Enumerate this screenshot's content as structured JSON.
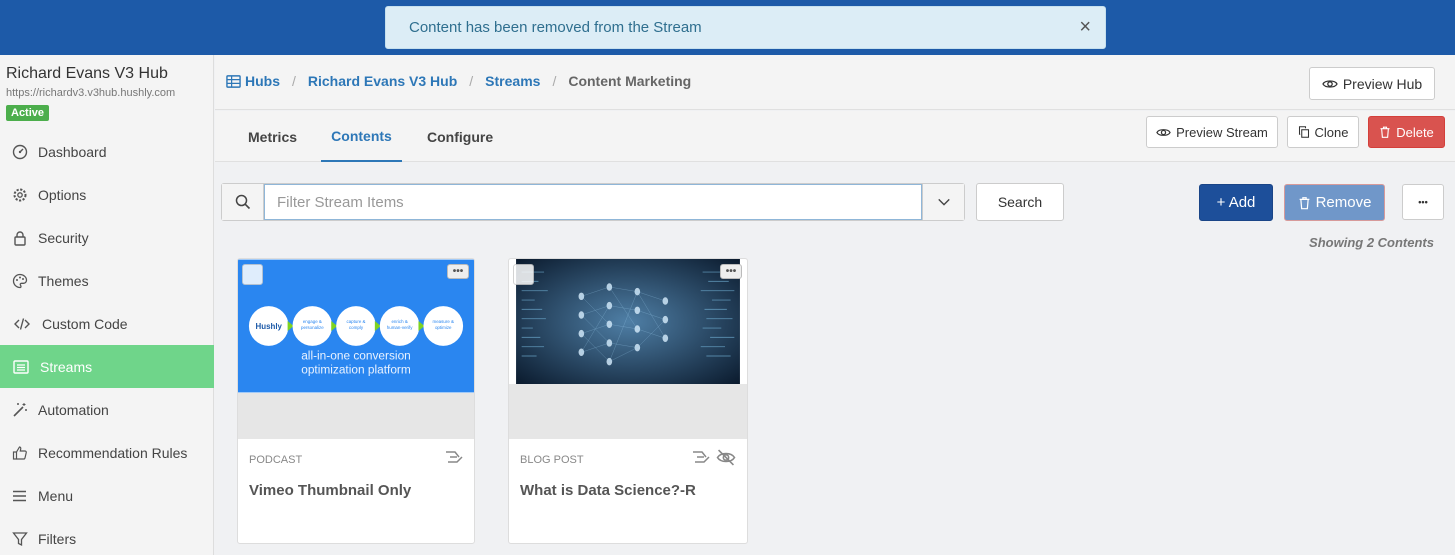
{
  "toast": {
    "message": "Content has been removed from the Stream",
    "close": "×"
  },
  "sidebar": {
    "hub_title": "Richard Evans V3 Hub",
    "hub_url": "https://richardv3.v3hub.hushly.com",
    "status": "Active",
    "items": [
      {
        "label": "Dashboard",
        "icon": "dashboard-icon"
      },
      {
        "label": "Options",
        "icon": "gear-icon"
      },
      {
        "label": "Security",
        "icon": "lock-icon"
      },
      {
        "label": "Themes",
        "icon": "palette-icon"
      },
      {
        "label": "Custom Code",
        "icon": "code-icon"
      },
      {
        "label": "Streams",
        "icon": "list-icon",
        "active": true
      },
      {
        "label": "Automation",
        "icon": "magic-wand-icon"
      },
      {
        "label": "Recommendation Rules",
        "icon": "thumbs-up-icon"
      },
      {
        "label": "Menu",
        "icon": "menu-icon"
      },
      {
        "label": "Filters",
        "icon": "filter-icon"
      }
    ]
  },
  "breadcrumb": {
    "hubs": "Hubs",
    "hub": "Richard Evans V3 Hub",
    "streams": "Streams",
    "current": "Content Marketing"
  },
  "header": {
    "preview_hub": "Preview Hub"
  },
  "tabs": {
    "metrics": "Metrics",
    "contents": "Contents",
    "configure": "Configure"
  },
  "actions": {
    "preview_stream": "Preview Stream",
    "clone": "Clone",
    "delete": "Delete"
  },
  "filter": {
    "placeholder": "Filter Stream Items",
    "search": "Search"
  },
  "toolbar": {
    "add": "+ Add",
    "remove": "Remove",
    "more": "•••"
  },
  "showing": "Showing 2 Contents",
  "cards": [
    {
      "type": "PODCAST",
      "title": "Vimeo Thumbnail Only",
      "thumb": {
        "brand": "Hushly",
        "steps": [
          "engage & personalize",
          "capture & comply",
          "enrich & human-verify",
          "measure & optimize"
        ],
        "tagline_1": "all-in-one conversion",
        "tagline_2": "optimization platform"
      }
    },
    {
      "type": "BLOG POST",
      "title": "What is Data Science?-R"
    }
  ],
  "colors": {
    "topbar": "#1d5aa8",
    "active_nav": "#6fd58a",
    "link": "#2d77b7",
    "delete": "#d9534f",
    "add": "#1d4f9a",
    "remove": "#7097c9"
  }
}
